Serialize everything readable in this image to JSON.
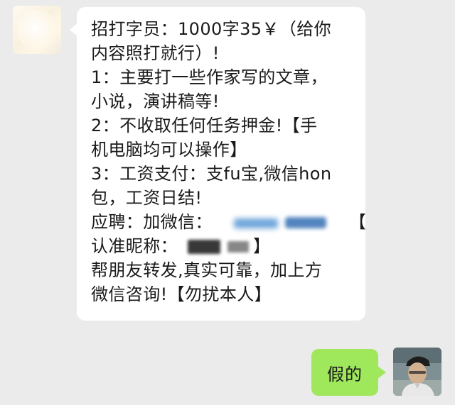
{
  "chat": {
    "incoming": {
      "lines": [
        "招打字员：1000字35￥（给你",
        "内容照打就行）!",
        "1：主要打一些作家写的文章，",
        "小说，演讲稿等!",
        "2：不收取任何任务押金!【手",
        "机电脑均可以操作】",
        "3：工资支付：支fu宝,微信hon",
        "包，工资日结!",
        "应聘：加微信：",
        "【",
        "认准昵称：",
        "】",
        "帮朋友转发,真实可靠，加上方",
        "微信咨询!【勿扰本人】"
      ]
    },
    "outgoing": {
      "text": "假的"
    }
  },
  "colors": {
    "background": "#ebebeb",
    "incoming_bubble": "#ffffff",
    "outgoing_bubble": "#9fe75b"
  },
  "icons": {
    "left_avatar": "contact-avatar-icon",
    "right_avatar": "user-avatar-icon"
  }
}
